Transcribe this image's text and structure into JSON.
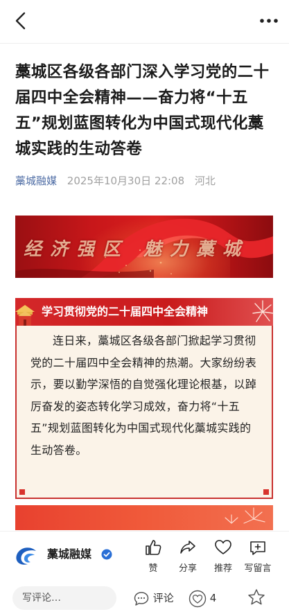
{
  "header": {
    "back_icon": "chevron-left-icon",
    "more_icon": "ellipsis-icon"
  },
  "article": {
    "title": "藁城区各级各部门深入学习党的二十届四中全会精神——奋力将“十五五”规划蓝图转化为中国式现代化藁城实践的生动答卷",
    "source": "藁城融媒",
    "date": "2025年10月30日 22:08",
    "region": "河北"
  },
  "banner": {
    "text": "经济强区 魅力藁城"
  },
  "card": {
    "title": "学习贯彻党的二十届四中全会精神",
    "body": "连日来，藁城区各级各部门掀起学习贯彻党的二十届四中全会精神的热潮。大家纷纷表示，要以勤学深悟的自觉强化理论根基，以踔厉奋发的姿态转化学习成效，奋力将“十五五”规划蓝图转化为中国式现代化藁城实践的生动答卷。"
  },
  "actionbar": {
    "brand_name": "藁城融媒",
    "like_label": "赞",
    "share_label": "分享",
    "recommend_label": "推荐",
    "message_label": "写留言"
  },
  "bottombar": {
    "comment_placeholder": "写评论…",
    "comment_label": "评论",
    "like_count": "4"
  },
  "colors": {
    "accent_red": "#c91a1c",
    "source_blue": "#4b6aa3",
    "card_bg": "#fbf3e8"
  }
}
